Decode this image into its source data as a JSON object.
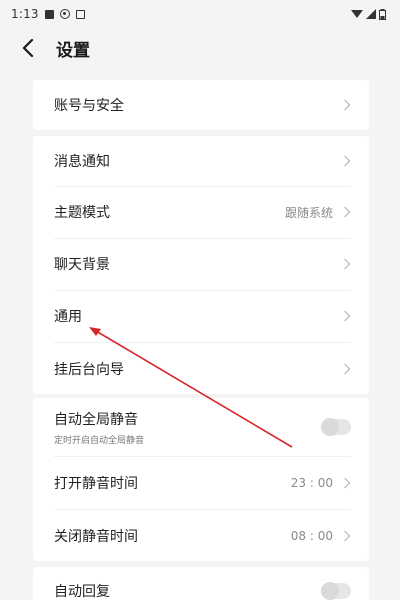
{
  "status_bar": {
    "time": "1:13",
    "icons": [
      "image-icon",
      "sound-icon",
      "notification-icon"
    ],
    "right_icons": [
      "wifi-icon",
      "signal-icon",
      "battery-icon"
    ]
  },
  "header": {
    "back_icon": "chevron-left-icon",
    "title": "设置"
  },
  "groups": [
    {
      "items": [
        {
          "label": "账号与安全"
        }
      ]
    },
    {
      "items": [
        {
          "label": "消息通知"
        },
        {
          "label": "主题模式",
          "value": "跟随系统"
        },
        {
          "label": "聊天背景"
        },
        {
          "label": "通用"
        },
        {
          "label": "挂后台向导"
        }
      ]
    },
    {
      "items": [
        {
          "label": "自动全局静音",
          "sublabel": "定时开启自动全局静音",
          "toggle": false
        },
        {
          "label": "打开静音时间",
          "value": "23 : 00"
        },
        {
          "label": "关闭静音时间",
          "value": "08 : 00"
        }
      ]
    },
    {
      "items": [
        {
          "label": "自动回复",
          "toggle": false
        }
      ]
    }
  ],
  "colors": {
    "background": "#f4f4f4",
    "card": "#ffffff",
    "annotation_arrow": "#d9262b"
  }
}
